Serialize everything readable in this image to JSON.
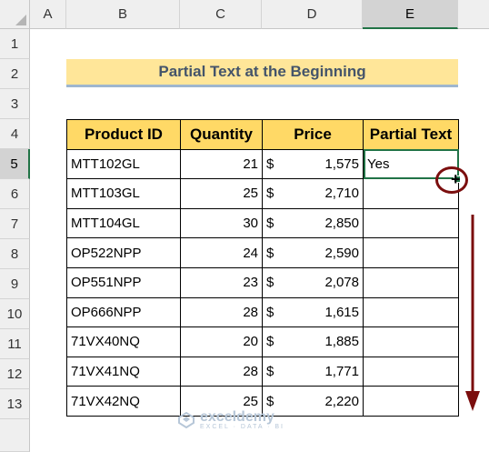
{
  "columns": [
    "A",
    "B",
    "C",
    "D",
    "E"
  ],
  "rows": [
    "1",
    "2",
    "3",
    "4",
    "5",
    "6",
    "7",
    "8",
    "9",
    "10",
    "11",
    "12",
    "13"
  ],
  "title": "Partial Text at the Beginning",
  "headers": [
    "Product ID",
    "Quantity",
    "Price",
    "Partial Text"
  ],
  "records": [
    {
      "id": "MTT102GL",
      "qty": "21",
      "cur": "$",
      "price": "1,575",
      "partial": "Yes"
    },
    {
      "id": "MTT103GL",
      "qty": "25",
      "cur": "$",
      "price": "2,710",
      "partial": ""
    },
    {
      "id": "MTT104GL",
      "qty": "30",
      "cur": "$",
      "price": "2,850",
      "partial": ""
    },
    {
      "id": "OP522NPP",
      "qty": "24",
      "cur": "$",
      "price": "2,590",
      "partial": ""
    },
    {
      "id": "OP551NPP",
      "qty": "23",
      "cur": "$",
      "price": "2,078",
      "partial": ""
    },
    {
      "id": "OP666NPP",
      "qty": "28",
      "cur": "$",
      "price": "1,615",
      "partial": ""
    },
    {
      "id": "71VX40NQ",
      "qty": "20",
      "cur": "$",
      "price": "1,885",
      "partial": ""
    },
    {
      "id": "71VX41NQ",
      "qty": "28",
      "cur": "$",
      "price": "1,771",
      "partial": ""
    },
    {
      "id": "71VX42NQ",
      "qty": "25",
      "cur": "$",
      "price": "2,220",
      "partial": ""
    }
  ],
  "watermark": {
    "name": "exceldemy",
    "tag": "EXCEL · DATA · BI"
  },
  "colors": {
    "accent": "#217346",
    "header_fill": "#ffd966",
    "title_fill": "#ffe699",
    "annotation": "#7b0e0e"
  }
}
